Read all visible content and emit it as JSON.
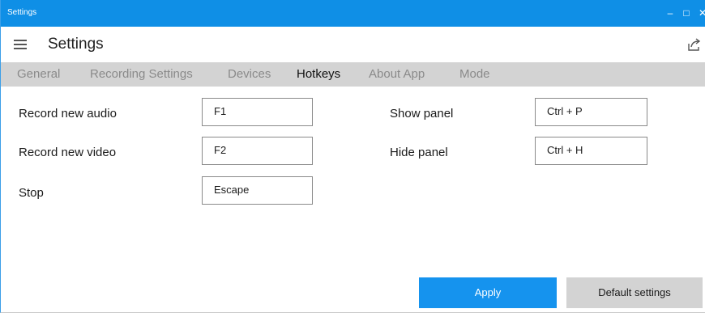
{
  "window": {
    "title": "Settings",
    "minimize_glyph": "–",
    "maximize_glyph": "□",
    "close_glyph": "✕",
    "accent_color": "#0f8fe6"
  },
  "header": {
    "title": "Settings",
    "menu_icon": "hamburger-icon",
    "share_icon": "share-icon"
  },
  "tabs": [
    {
      "label": "General",
      "active": false
    },
    {
      "label": "Recording Settings",
      "active": false
    },
    {
      "label": "Devices",
      "active": false
    },
    {
      "label": "Hotkeys",
      "active": true
    },
    {
      "label": "About App",
      "active": false
    },
    {
      "label": "Mode",
      "active": false
    }
  ],
  "hotkeys": {
    "left": [
      {
        "label": "Record new audio",
        "value": "F1"
      },
      {
        "label": "Record new video",
        "value": "F2"
      },
      {
        "label": "Stop",
        "value": "Escape"
      }
    ],
    "right": [
      {
        "label": "Show panel",
        "value": "Ctrl + P"
      },
      {
        "label": "Hide panel",
        "value": "Ctrl + H"
      }
    ]
  },
  "actions": {
    "apply_label": "Apply",
    "default_label": "Default settings",
    "apply_color": "#1593ee"
  }
}
